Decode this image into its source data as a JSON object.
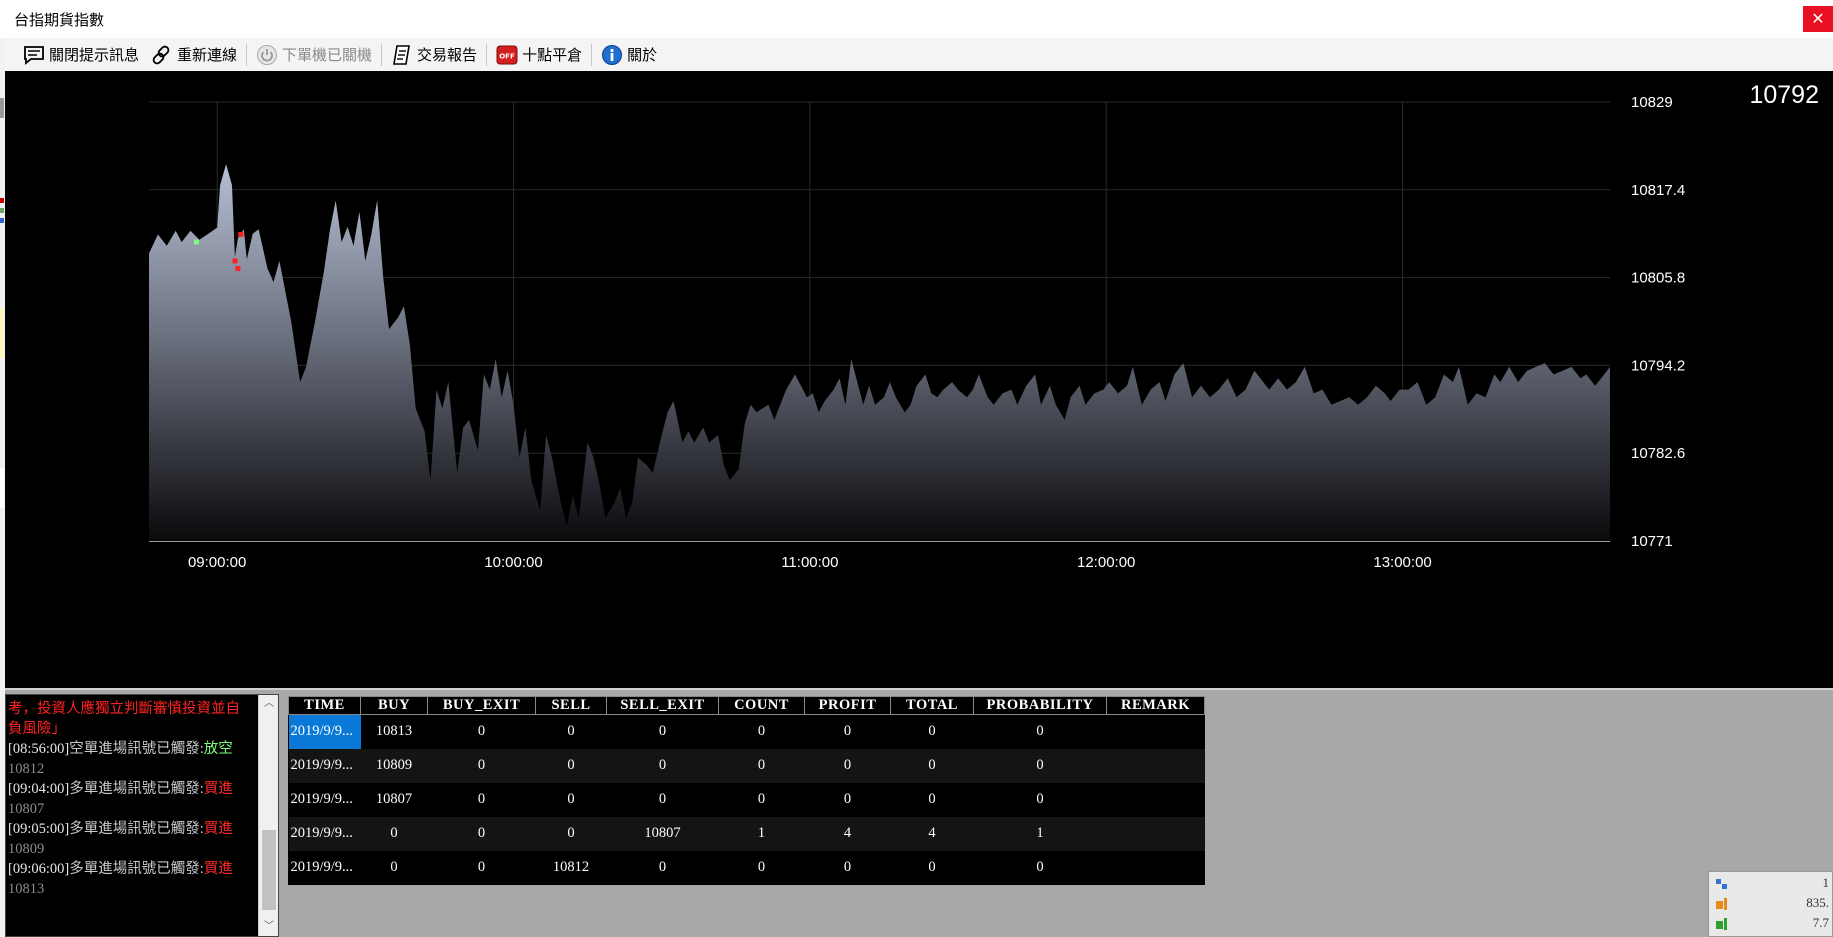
{
  "window": {
    "title": "台指期貨指數",
    "close_glyph": "✕"
  },
  "toolbar": {
    "items": [
      {
        "label": "關閉提示訊息",
        "icon": "message-icon",
        "enabled": true
      },
      {
        "label": "重新連線",
        "icon": "link-icon",
        "enabled": true
      },
      {
        "label": "下單機已關機",
        "icon": "power-icon",
        "enabled": false
      },
      {
        "label": "交易報告",
        "icon": "report-icon",
        "enabled": true
      },
      {
        "label": "十點平倉",
        "icon": "off-icon",
        "enabled": true
      },
      {
        "label": "關於",
        "icon": "info-icon",
        "enabled": true
      }
    ]
  },
  "chart": {
    "current_price": "10792"
  },
  "chart_data": {
    "type": "area",
    "y_ticks": [
      "10829",
      "10817.4",
      "10805.8",
      "10794.2",
      "10782.6",
      "10771"
    ],
    "ylim": [
      10771,
      10829
    ],
    "x_ticks": [
      "09:00:00",
      "10:00:00",
      "11:00:00",
      "12:00:00",
      "13:00:00"
    ],
    "x_range_minutes": [
      8.77,
      13.7
    ],
    "grid": true,
    "series": [
      {
        "values": [
          [
            8.77,
            10809.0
          ],
          [
            8.8,
            10811.5
          ],
          [
            8.83,
            10810.0
          ],
          [
            8.86,
            10812.0
          ],
          [
            8.88,
            10810.5
          ],
          [
            8.91,
            10812.0
          ],
          [
            8.94,
            10810.8
          ],
          [
            8.97,
            10811.6
          ],
          [
            9.0,
            10812.4
          ],
          [
            9.01,
            10818.0
          ],
          [
            9.03,
            10820.8
          ],
          [
            9.05,
            10818.0
          ],
          [
            9.06,
            10808.5
          ],
          [
            9.07,
            10811.0
          ],
          [
            9.09,
            10812.2
          ],
          [
            9.1,
            10808.2
          ],
          [
            9.12,
            10811.6
          ],
          [
            9.14,
            10812.2
          ],
          [
            9.17,
            10807.0
          ],
          [
            9.19,
            10805.2
          ],
          [
            9.21,
            10808.0
          ],
          [
            9.23,
            10804.0
          ],
          [
            9.25,
            10800.0
          ],
          [
            9.28,
            10792.0
          ],
          [
            9.3,
            10794.0
          ],
          [
            9.33,
            10800.0
          ],
          [
            9.36,
            10806.5
          ],
          [
            9.38,
            10812.0
          ],
          [
            9.4,
            10816.0
          ],
          [
            9.42,
            10810.5
          ],
          [
            9.44,
            10812.5
          ],
          [
            9.46,
            10810.0
          ],
          [
            9.48,
            10814.5
          ],
          [
            9.5,
            10808.0
          ],
          [
            9.52,
            10811.5
          ],
          [
            9.54,
            10816.0
          ],
          [
            9.56,
            10806.0
          ],
          [
            9.58,
            10799.0
          ],
          [
            9.61,
            10800.5
          ],
          [
            9.63,
            10802.0
          ],
          [
            9.65,
            10797.0
          ],
          [
            9.67,
            10788.5
          ],
          [
            9.7,
            10785.5
          ],
          [
            9.72,
            10779.0
          ],
          [
            9.74,
            10791.0
          ],
          [
            9.76,
            10788.5
          ],
          [
            9.78,
            10792.0
          ],
          [
            9.81,
            10780.0
          ],
          [
            9.83,
            10786.0
          ],
          [
            9.85,
            10787.0
          ],
          [
            9.88,
            10783.0
          ],
          [
            9.9,
            10793.0
          ],
          [
            9.92,
            10791.0
          ],
          [
            9.94,
            10795.0
          ],
          [
            9.96,
            10790.0
          ],
          [
            9.98,
            10793.5
          ],
          [
            10.0,
            10789.0
          ],
          [
            10.02,
            10782.0
          ],
          [
            10.04,
            10786.0
          ],
          [
            10.06,
            10779.0
          ],
          [
            10.09,
            10775.0
          ],
          [
            10.11,
            10785.0
          ],
          [
            10.13,
            10782.0
          ],
          [
            10.16,
            10776.0
          ],
          [
            10.18,
            10773.0
          ],
          [
            10.2,
            10777.0
          ],
          [
            10.22,
            10774.0
          ],
          [
            10.25,
            10784.0
          ],
          [
            10.27,
            10782.0
          ],
          [
            10.29,
            10778.5
          ],
          [
            10.31,
            10774.0
          ],
          [
            10.34,
            10776.0
          ],
          [
            10.36,
            10778.0
          ],
          [
            10.38,
            10774.0
          ],
          [
            10.4,
            10776.0
          ],
          [
            10.42,
            10782.0
          ],
          [
            10.45,
            10781.0
          ],
          [
            10.47,
            10780.0
          ],
          [
            10.5,
            10785.0
          ],
          [
            10.52,
            10788.0
          ],
          [
            10.54,
            10789.5
          ],
          [
            10.57,
            10784.0
          ],
          [
            10.59,
            10785.5
          ],
          [
            10.61,
            10784.0
          ],
          [
            10.64,
            10786.0
          ],
          [
            10.66,
            10784.0
          ],
          [
            10.69,
            10785.0
          ],
          [
            10.71,
            10781.0
          ],
          [
            10.73,
            10779.0
          ],
          [
            10.76,
            10780.5
          ],
          [
            10.78,
            10786.5
          ],
          [
            10.8,
            10789.0
          ],
          [
            10.82,
            10788.0
          ],
          [
            10.84,
            10788.5
          ],
          [
            10.86,
            10789.0
          ],
          [
            10.88,
            10787.0
          ],
          [
            10.9,
            10789.0
          ],
          [
            10.92,
            10791.0
          ],
          [
            10.95,
            10793.0
          ],
          [
            10.97,
            10791.5
          ],
          [
            10.99,
            10790.0
          ],
          [
            11.01,
            10790.5
          ],
          [
            11.03,
            10788.0
          ],
          [
            11.05,
            10789.5
          ],
          [
            11.08,
            10791.0
          ],
          [
            11.1,
            10792.5
          ],
          [
            11.12,
            10789.0
          ],
          [
            11.14,
            10795.0
          ],
          [
            11.16,
            10792.0
          ],
          [
            11.18,
            10789.0
          ],
          [
            11.2,
            10791.5
          ],
          [
            11.22,
            10789.0
          ],
          [
            11.25,
            10790.0
          ],
          [
            11.27,
            10792.0
          ],
          [
            11.29,
            10790.0
          ],
          [
            11.32,
            10788.0
          ],
          [
            11.34,
            10789.0
          ],
          [
            11.36,
            10791.5
          ],
          [
            11.39,
            10793.0
          ],
          [
            11.41,
            10790.5
          ],
          [
            11.43,
            10790.0
          ],
          [
            11.45,
            10791.0
          ],
          [
            11.48,
            10792.0
          ],
          [
            11.5,
            10791.0
          ],
          [
            11.53,
            10790.0
          ],
          [
            11.55,
            10791.0
          ],
          [
            11.57,
            10793.0
          ],
          [
            11.6,
            10790.0
          ],
          [
            11.62,
            10789.0
          ],
          [
            11.65,
            10790.5
          ],
          [
            11.68,
            10791.0
          ],
          [
            11.7,
            10789.0
          ],
          [
            11.73,
            10791.5
          ],
          [
            11.76,
            10793.0
          ],
          [
            11.78,
            10789.0
          ],
          [
            11.81,
            10791.5
          ],
          [
            11.83,
            10789.0
          ],
          [
            11.86,
            10787.0
          ],
          [
            11.88,
            10790.0
          ],
          [
            11.91,
            10791.5
          ],
          [
            11.93,
            10789.0
          ],
          [
            11.96,
            10790.5
          ],
          [
            11.99,
            10791.0
          ],
          [
            12.01,
            10792.0
          ],
          [
            12.04,
            10790.5
          ],
          [
            12.07,
            10791.5
          ],
          [
            12.09,
            10794.0
          ],
          [
            12.12,
            10789.0
          ],
          [
            12.15,
            10791.0
          ],
          [
            12.18,
            10792.0
          ],
          [
            12.2,
            10789.5
          ],
          [
            12.23,
            10793.0
          ],
          [
            12.26,
            10794.5
          ],
          [
            12.29,
            10790.0
          ],
          [
            12.32,
            10791.5
          ],
          [
            12.35,
            10790.0
          ],
          [
            12.38,
            10791.0
          ],
          [
            12.41,
            10792.5
          ],
          [
            12.44,
            10790.0
          ],
          [
            12.47,
            10791.0
          ],
          [
            12.5,
            10793.5
          ],
          [
            12.52,
            10792.5
          ],
          [
            12.55,
            10791.0
          ],
          [
            12.58,
            10792.5
          ],
          [
            12.61,
            10791.0
          ],
          [
            12.64,
            10792.0
          ],
          [
            12.67,
            10794.0
          ],
          [
            12.7,
            10790.5
          ],
          [
            12.73,
            10791.0
          ],
          [
            12.76,
            10789.0
          ],
          [
            12.79,
            10789.5
          ],
          [
            12.82,
            10790.0
          ],
          [
            12.85,
            10789.0
          ],
          [
            12.88,
            10790.0
          ],
          [
            12.91,
            10791.5
          ],
          [
            12.94,
            10790.5
          ],
          [
            12.96,
            10789.5
          ],
          [
            12.99,
            10791.0
          ],
          [
            13.02,
            10791.0
          ],
          [
            13.05,
            10792.0
          ],
          [
            13.08,
            10789.0
          ],
          [
            13.11,
            10790.0
          ],
          [
            13.14,
            10793.0
          ],
          [
            13.17,
            10792.0
          ],
          [
            13.19,
            10794.0
          ],
          [
            13.22,
            10789.0
          ],
          [
            13.25,
            10790.5
          ],
          [
            13.28,
            10790.0
          ],
          [
            13.31,
            10793.0
          ],
          [
            13.33,
            10792.0
          ],
          [
            13.36,
            10794.0
          ],
          [
            13.39,
            10792.0
          ],
          [
            13.42,
            10793.5
          ],
          [
            13.45,
            10794.0
          ],
          [
            13.48,
            10794.5
          ],
          [
            13.51,
            10793.0
          ],
          [
            13.54,
            10793.5
          ],
          [
            13.57,
            10794.0
          ],
          [
            13.6,
            10792.5
          ],
          [
            13.62,
            10793.0
          ],
          [
            13.65,
            10791.5
          ],
          [
            13.68,
            10793.0
          ],
          [
            13.7,
            10794.0
          ]
        ]
      }
    ],
    "markers": [
      {
        "x": 8.93,
        "y": 10810.5,
        "color": "#7dff7d"
      },
      {
        "x": 9.06,
        "y": 10808.0,
        "color": "#ff2020"
      },
      {
        "x": 9.07,
        "y": 10807.0,
        "color": "#ff2020"
      },
      {
        "x": 9.08,
        "y": 10811.5,
        "color": "#ff2020"
      }
    ]
  },
  "log": {
    "warning": "考，投資人應獨立判斷審慎投資並自負風險」",
    "entries": [
      {
        "time": "[08:56:00]",
        "text": "空單進場訊號已觸發:",
        "action": "放空",
        "action_color": "green",
        "price": "10812"
      },
      {
        "time": "[09:04:00]",
        "text": "多單進場訊號已觸發:",
        "action": "買進",
        "action_color": "red",
        "price": "10807"
      },
      {
        "time": "[09:05:00]",
        "text": "多單進場訊號已觸發:",
        "action": "買進",
        "action_color": "red",
        "price": "10809"
      },
      {
        "time": "[09:06:00]",
        "text": "多單進場訊號已觸發:",
        "action": "買進",
        "action_color": "red",
        "price": "10813"
      }
    ],
    "scroll_up": "︿",
    "scroll_down": "﹀"
  },
  "grid": {
    "columns": [
      "TIME",
      "BUY",
      "BUY_EXIT",
      "SELL",
      "SELL_EXIT",
      "COUNT",
      "PROFIT",
      "TOTAL",
      "PROBABILITY",
      "REMARK"
    ],
    "rows": [
      [
        "2019/9/9...",
        "10813",
        "0",
        "0",
        "0",
        "0",
        "0",
        "0",
        "0",
        ""
      ],
      [
        "2019/9/9...",
        "10809",
        "0",
        "0",
        "0",
        "0",
        "0",
        "0",
        "0",
        ""
      ],
      [
        "2019/9/9...",
        "10807",
        "0",
        "0",
        "0",
        "0",
        "0",
        "0",
        "0",
        ""
      ],
      [
        "2019/9/9...",
        "0",
        "0",
        "0",
        "10807",
        "1",
        "4",
        "4",
        "1",
        ""
      ],
      [
        "2019/9/9...",
        "0",
        "0",
        "10812",
        "0",
        "0",
        "0",
        "0",
        "0",
        ""
      ]
    ]
  },
  "mini_widget": {
    "rows": [
      {
        "icon": "network-icon",
        "value": "1"
      },
      {
        "icon": "bar-icon",
        "value": "835."
      },
      {
        "icon": "bar-icon",
        "value": "7.7"
      }
    ]
  }
}
